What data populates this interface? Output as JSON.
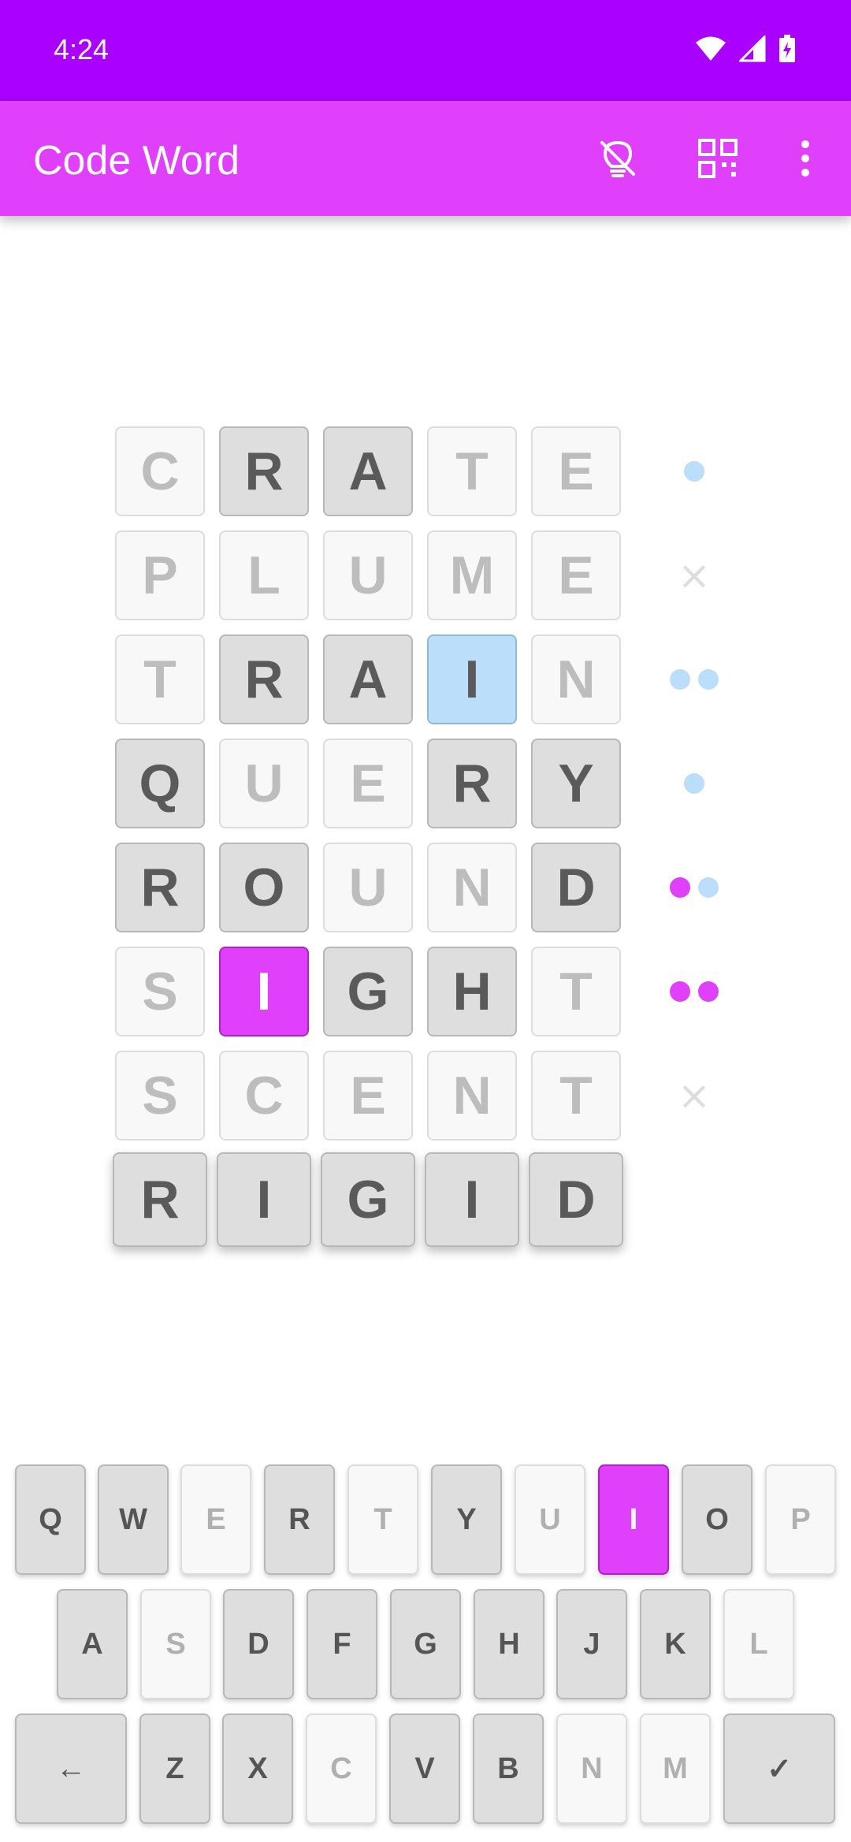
{
  "status_bar": {
    "time": "4:24"
  },
  "app_bar": {
    "title": "Code Word",
    "actions": [
      "lightbulb-off-icon",
      "qr-code-icon",
      "more-vert-icon"
    ]
  },
  "colors": {
    "status_bar": "#aa00ff",
    "app_bar": "#e040fb",
    "correct_position": "#e040fb",
    "wrong_position": "#bbdefb",
    "used_letter": "#dedede",
    "absent_letter": "#f8f8f8"
  },
  "guesses": [
    {
      "letters": [
        {
          "char": "C",
          "state": "absent"
        },
        {
          "char": "R",
          "state": "used"
        },
        {
          "char": "A",
          "state": "used"
        },
        {
          "char": "T",
          "state": "absent"
        },
        {
          "char": "E",
          "state": "absent"
        }
      ],
      "markers": [
        "blue"
      ]
    },
    {
      "letters": [
        {
          "char": "P",
          "state": "absent"
        },
        {
          "char": "L",
          "state": "absent"
        },
        {
          "char": "U",
          "state": "absent"
        },
        {
          "char": "M",
          "state": "absent"
        },
        {
          "char": "E",
          "state": "absent"
        }
      ],
      "markers": [
        "none"
      ]
    },
    {
      "letters": [
        {
          "char": "T",
          "state": "absent"
        },
        {
          "char": "R",
          "state": "used"
        },
        {
          "char": "A",
          "state": "used"
        },
        {
          "char": "I",
          "state": "wrong_position"
        },
        {
          "char": "N",
          "state": "absent"
        }
      ],
      "markers": [
        "blue",
        "blue"
      ]
    },
    {
      "letters": [
        {
          "char": "Q",
          "state": "used"
        },
        {
          "char": "U",
          "state": "absent"
        },
        {
          "char": "E",
          "state": "absent"
        },
        {
          "char": "R",
          "state": "used"
        },
        {
          "char": "Y",
          "state": "used"
        }
      ],
      "markers": [
        "blue"
      ]
    },
    {
      "letters": [
        {
          "char": "R",
          "state": "used"
        },
        {
          "char": "O",
          "state": "used"
        },
        {
          "char": "U",
          "state": "absent"
        },
        {
          "char": "N",
          "state": "absent"
        },
        {
          "char": "D",
          "state": "used"
        }
      ],
      "markers": [
        "pink",
        "blue"
      ]
    },
    {
      "letters": [
        {
          "char": "S",
          "state": "absent"
        },
        {
          "char": "I",
          "state": "correct"
        },
        {
          "char": "G",
          "state": "used"
        },
        {
          "char": "H",
          "state": "used"
        },
        {
          "char": "T",
          "state": "absent"
        }
      ],
      "markers": [
        "pink",
        "pink"
      ]
    },
    {
      "letters": [
        {
          "char": "S",
          "state": "absent"
        },
        {
          "char": "C",
          "state": "absent"
        },
        {
          "char": "E",
          "state": "absent"
        },
        {
          "char": "N",
          "state": "absent"
        },
        {
          "char": "T",
          "state": "absent"
        }
      ],
      "markers": [
        "none"
      ]
    }
  ],
  "current_guess": [
    "R",
    "I",
    "G",
    "I",
    "D"
  ],
  "keyboard": {
    "rows": [
      [
        {
          "label": "Q",
          "state": "used"
        },
        {
          "label": "W",
          "state": "used"
        },
        {
          "label": "E",
          "state": "absent"
        },
        {
          "label": "R",
          "state": "used"
        },
        {
          "label": "T",
          "state": "absent"
        },
        {
          "label": "Y",
          "state": "used"
        },
        {
          "label": "U",
          "state": "absent"
        },
        {
          "label": "I",
          "state": "correct"
        },
        {
          "label": "O",
          "state": "used"
        },
        {
          "label": "P",
          "state": "absent"
        }
      ],
      [
        {
          "label": "A",
          "state": "used"
        },
        {
          "label": "S",
          "state": "absent"
        },
        {
          "label": "D",
          "state": "used"
        },
        {
          "label": "F",
          "state": "used"
        },
        {
          "label": "G",
          "state": "used"
        },
        {
          "label": "H",
          "state": "used"
        },
        {
          "label": "J",
          "state": "used"
        },
        {
          "label": "K",
          "state": "used"
        },
        {
          "label": "L",
          "state": "absent"
        }
      ],
      [
        {
          "label": "←",
          "state": "used",
          "role": "backspace-key"
        },
        {
          "label": "Z",
          "state": "used"
        },
        {
          "label": "X",
          "state": "used"
        },
        {
          "label": "C",
          "state": "absent"
        },
        {
          "label": "V",
          "state": "used"
        },
        {
          "label": "B",
          "state": "used"
        },
        {
          "label": "N",
          "state": "absent"
        },
        {
          "label": "M",
          "state": "absent"
        },
        {
          "label": "✓",
          "state": "used",
          "role": "enter-key"
        }
      ]
    ]
  }
}
